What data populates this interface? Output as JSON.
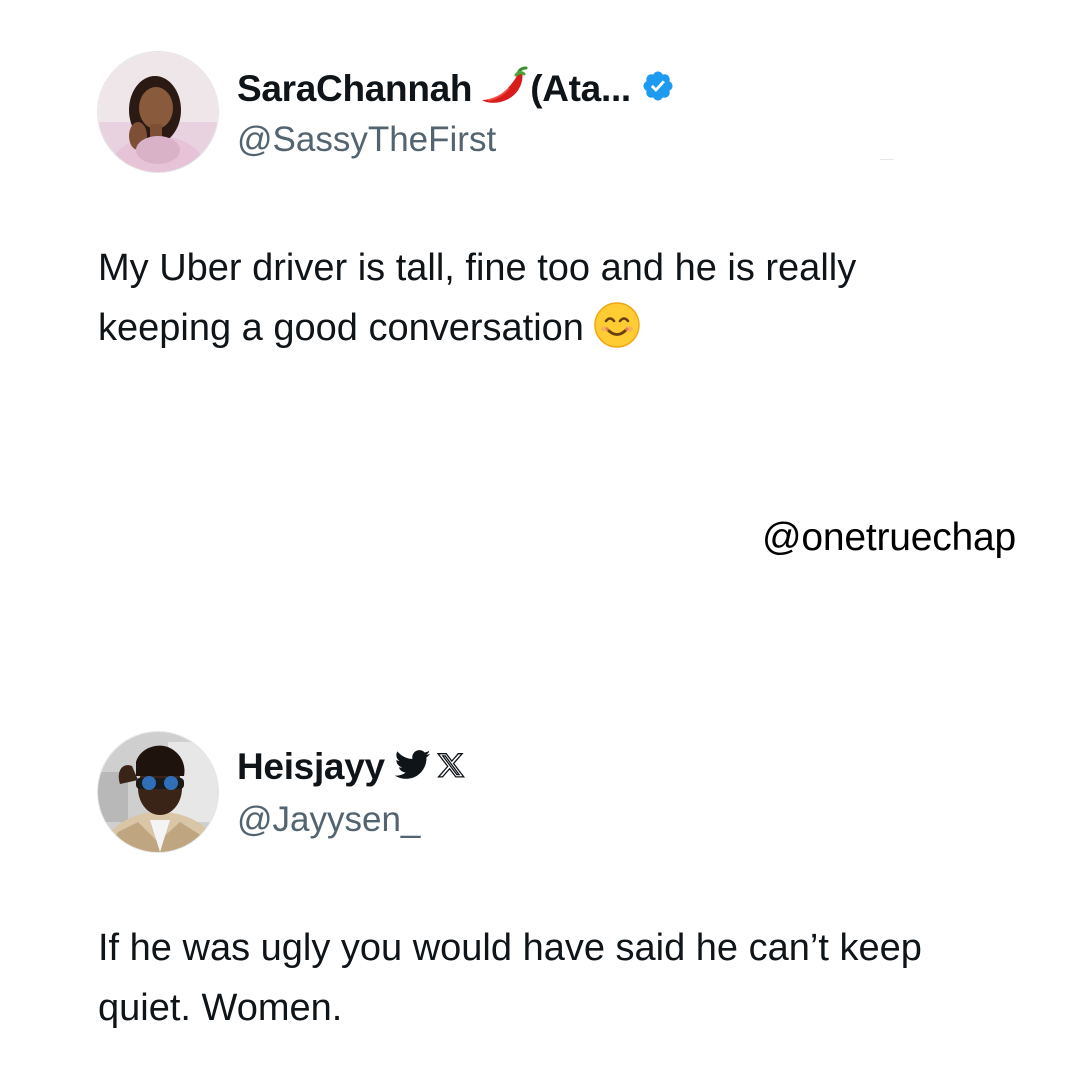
{
  "tweets": [
    {
      "display_name": "SaraChannah",
      "name_suffix": "(Ata...",
      "handle": "@SassyTheFirst",
      "text": "My Uber driver is tall, fine too and he is really keeping a good conversation",
      "icons": [
        "avatar",
        "chili-pepper-icon",
        "verified-badge-icon",
        "smiling-face-emoji-icon"
      ]
    },
    {
      "display_name": "Heisjayy",
      "handle": "@Jayysen_",
      "text": "If he was ugly you would have said he can’t keep quiet. Women.",
      "icons": [
        "avatar",
        "twitter-bird-icon",
        "x-logo-icon"
      ]
    }
  ],
  "watermark": "@onetruechap",
  "colors": {
    "text": "#0f1419",
    "handle": "#536471",
    "verified": "#1d9bf0"
  }
}
